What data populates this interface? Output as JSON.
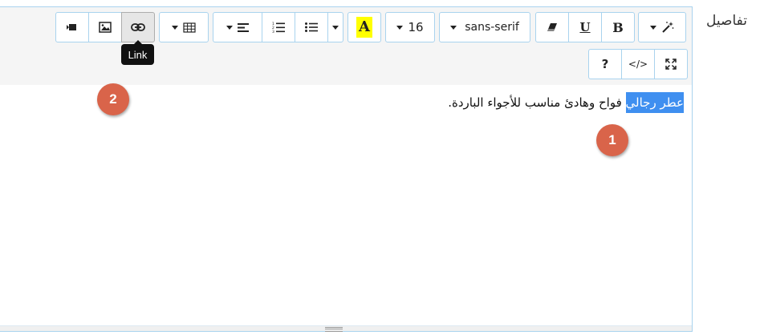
{
  "field": {
    "label": "تفاصيل"
  },
  "toolbar": {
    "magic_icon": "magic-wand-icon",
    "bold_label": "B",
    "underline_label": "U",
    "eraser_icon": "eraser-icon",
    "font_family": "sans-serif",
    "font_size": "16",
    "color_label": "A",
    "highlight_color": "#ffff00",
    "unordered_list_icon": "unordered-list-icon",
    "ordered_list_icon": "ordered-list-icon",
    "align_icon": "align-left-icon",
    "table_icon": "table-icon",
    "link_icon": "link-icon",
    "picture_icon": "picture-icon",
    "video_icon": "video-icon",
    "fullscreen_icon": "fullscreen-icon",
    "codeview_label": "</>",
    "help_label": "?"
  },
  "tooltip": {
    "text": "Link"
  },
  "content": {
    "selected_text": "عطر رجالي",
    "rest_text": " فواح وهادئ مناسب للأجواء الباردة."
  },
  "markers": {
    "m1": "1",
    "m2": "2"
  },
  "colors": {
    "border": "#a9d3ee",
    "selection": "#3f8ff0",
    "marker": "#d9644a"
  }
}
